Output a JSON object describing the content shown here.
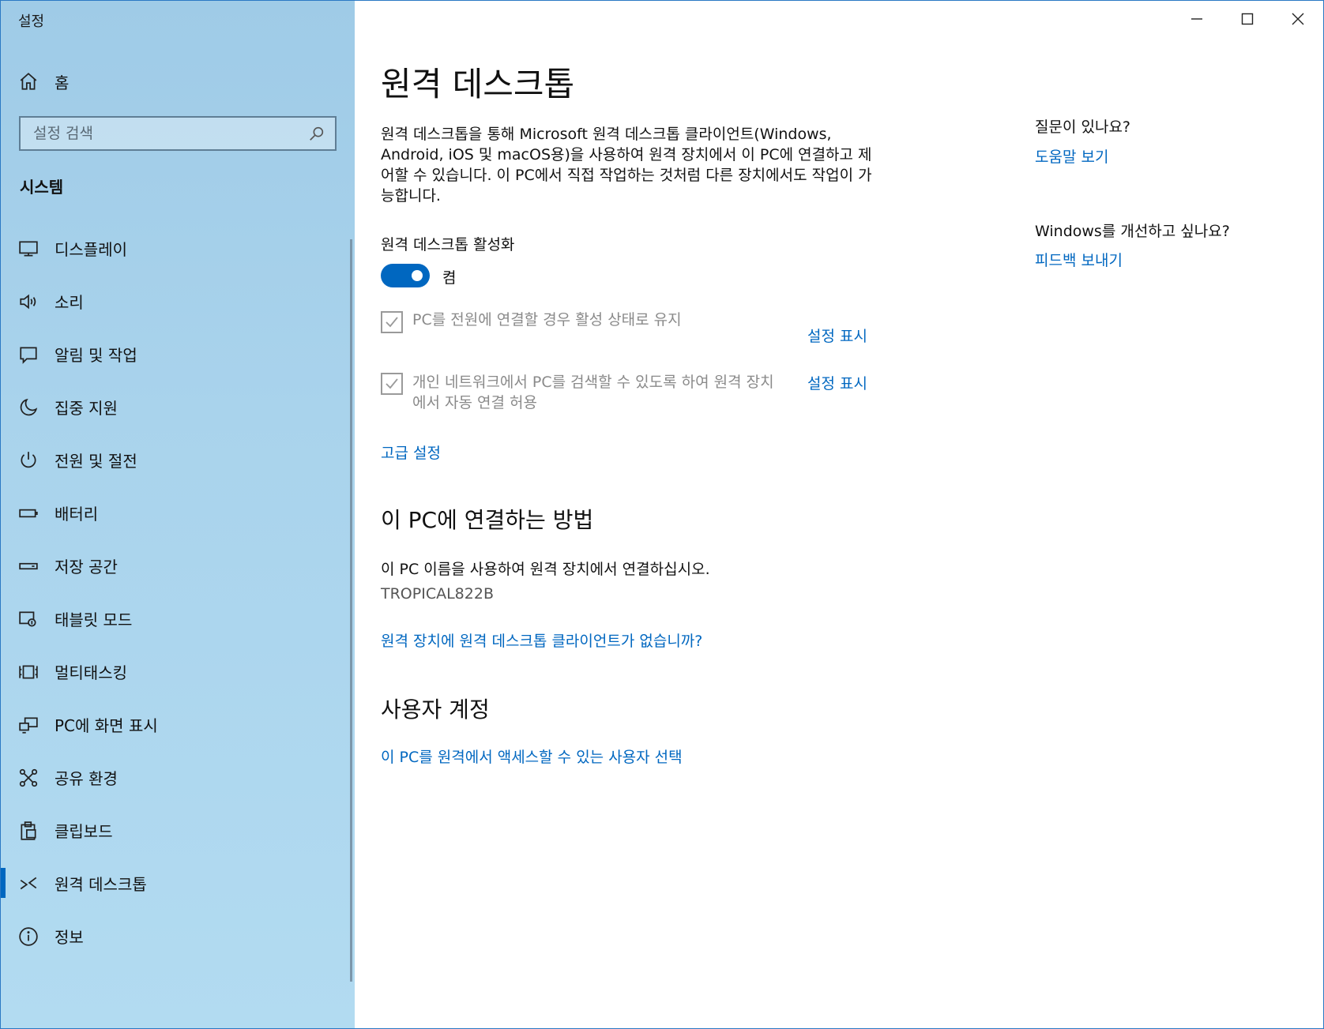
{
  "window": {
    "title": "설정"
  },
  "sidebar": {
    "home": "홈",
    "search_placeholder": "설정 검색",
    "section": "시스템",
    "items": [
      {
        "label": "디스플레이",
        "icon": "display-icon"
      },
      {
        "label": "소리",
        "icon": "speaker-icon"
      },
      {
        "label": "알림 및 작업",
        "icon": "notification-icon"
      },
      {
        "label": "집중 지원",
        "icon": "moon-icon"
      },
      {
        "label": "전원 및 절전",
        "icon": "power-icon"
      },
      {
        "label": "배터리",
        "icon": "battery-icon"
      },
      {
        "label": "저장 공간",
        "icon": "storage-icon"
      },
      {
        "label": "태블릿 모드",
        "icon": "tablet-icon"
      },
      {
        "label": "멀티태스킹",
        "icon": "multitasking-icon"
      },
      {
        "label": "PC에 화면 표시",
        "icon": "project-icon"
      },
      {
        "label": "공유 환경",
        "icon": "shared-icon"
      },
      {
        "label": "클립보드",
        "icon": "clipboard-icon"
      },
      {
        "label": "원격 데스크톱",
        "icon": "remote-desktop-icon",
        "active": true
      },
      {
        "label": "정보",
        "icon": "info-icon"
      }
    ]
  },
  "main": {
    "title": "원격 데스크톱",
    "description": "원격 데스크톱을 통해 Microsoft 원격 데스크톱 클라이언트(Windows, Android, iOS 및 macOS용)을 사용하여 원격 장치에서 이 PC에 연결하고 제어할 수 있습니다. 이 PC에서 직접 작업하는 것처럼 다른 장치에서도 작업이 가능합니다.",
    "enable_label": "원격 데스크톱 활성화",
    "toggle_state": "켬",
    "toggle_on": true,
    "option1": {
      "label": "PC를 전원에 연결할 경우 활성 상태로 유지",
      "link": "설정 표시",
      "checked": true
    },
    "option2": {
      "label": "개인 네트워크에서 PC를 검색할 수 있도록 하여 원격 장치에서 자동 연결 허용",
      "link": "설정 표시",
      "checked": true
    },
    "advanced_link": "고급 설정",
    "connect_heading": "이 PC에 연결하는 방법",
    "connect_text": "이 PC 이름을 사용하여 원격 장치에서 연결하십시오.",
    "pc_name": "TROPICAL822B",
    "no_client_link": "원격 장치에 원격 데스크톱 클라이언트가 없습니까?",
    "accounts_heading": "사용자 계정",
    "accounts_link": "이 PC를 원격에서 액세스할 수 있는 사용자 선택"
  },
  "aside": {
    "question": "질문이 있나요?",
    "help_link": "도움말 보기",
    "improve": "Windows를 개선하고 싶나요?",
    "feedback_link": "피드백 보내기"
  },
  "colors": {
    "accent": "#0067c0",
    "sidebar_bg": "#a9d3ec"
  }
}
